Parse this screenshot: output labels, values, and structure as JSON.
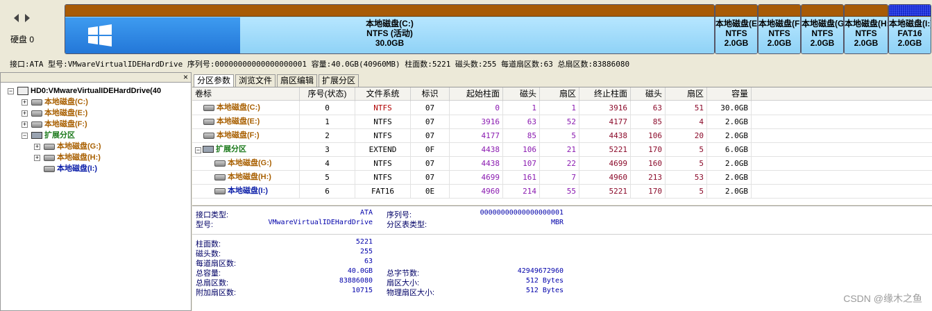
{
  "disk": {
    "label": "硬盘 0",
    "info": "接口:ATA  型号:VMwareVirtualIDEHardDrive  序列号:00000000000000000001  容量:40.0GB(40960MB)  柱面数:5221  磁头数:255  每道扇区数:63  总扇区数:83886080"
  },
  "partitions_bar": [
    {
      "name": "本地磁盘(C:)",
      "fs": "NTFS (活动)",
      "size": "30.0GB",
      "used_fraction": 0.27
    },
    {
      "name": "本地磁盘(E:)",
      "fs": "NTFS",
      "size": "2.0GB",
      "used_fraction": 0
    },
    {
      "name": "本地磁盘(F:)",
      "fs": "NTFS",
      "size": "2.0GB",
      "used_fraction": 0
    },
    {
      "name": "本地磁盘(G:)",
      "fs": "NTFS",
      "size": "2.0GB",
      "used_fraction": 0
    },
    {
      "name": "本地磁盘(H:)",
      "fs": "NTFS",
      "size": "2.0GB",
      "used_fraction": 0
    },
    {
      "name": "本地磁盘(I:)",
      "fs": "FAT16",
      "size": "2.0GB",
      "used_fraction": 0
    }
  ],
  "tree": {
    "close_label": "×",
    "root": "HD0:VMwareVirtualIDEHardDrive(40",
    "items": [
      {
        "label": "本地磁盘(C:)",
        "color": "#a85f00"
      },
      {
        "label": "本地磁盘(E:)",
        "color": "#a85f00"
      },
      {
        "label": "本地磁盘(F:)",
        "color": "#a85f00"
      },
      {
        "label": "扩展分区",
        "color": "#1c7a1c"
      },
      {
        "label": "本地磁盘(G:)",
        "color": "#a85f00"
      },
      {
        "label": "本地磁盘(H:)",
        "color": "#a85f00"
      },
      {
        "label": "本地磁盘(I:)",
        "color": "#0b1ea8"
      }
    ]
  },
  "tabs": [
    "分区参数",
    "浏览文件",
    "扇区编辑",
    "扩展分区"
  ],
  "table": {
    "headers": [
      "卷标",
      "序号(状态)",
      "文件系统",
      "标识",
      "起始柱面",
      "磁头",
      "扇区",
      "终止柱面",
      "磁头",
      "扇区",
      "容量"
    ],
    "rows": [
      {
        "label": "本地磁盘(C:)",
        "idx": "0",
        "fs": "NTFS",
        "id": "07",
        "sc": "0",
        "sh": "1",
        "ss": "1",
        "ec": "3916",
        "eh": "63",
        "es": "51",
        "cap": "30.0GB"
      },
      {
        "label": "本地磁盘(E:)",
        "idx": "1",
        "fs": "NTFS",
        "id": "07",
        "sc": "3916",
        "sh": "63",
        "ss": "52",
        "ec": "4177",
        "eh": "85",
        "es": "4",
        "cap": "2.0GB"
      },
      {
        "label": "本地磁盘(F:)",
        "idx": "2",
        "fs": "NTFS",
        "id": "07",
        "sc": "4177",
        "sh": "85",
        "ss": "5",
        "ec": "4438",
        "eh": "106",
        "es": "20",
        "cap": "2.0GB"
      },
      {
        "label": "扩展分区",
        "idx": "3",
        "fs": "EXTEND",
        "id": "0F",
        "sc": "4438",
        "sh": "106",
        "ss": "21",
        "ec": "5221",
        "eh": "170",
        "es": "5",
        "cap": "6.0GB"
      },
      {
        "label": "本地磁盘(G:)",
        "idx": "4",
        "fs": "NTFS",
        "id": "07",
        "sc": "4438",
        "sh": "107",
        "ss": "22",
        "ec": "4699",
        "eh": "160",
        "es": "5",
        "cap": "2.0GB"
      },
      {
        "label": "本地磁盘(H:)",
        "idx": "5",
        "fs": "NTFS",
        "id": "07",
        "sc": "4699",
        "sh": "161",
        "ss": "7",
        "ec": "4960",
        "eh": "213",
        "es": "53",
        "cap": "2.0GB"
      },
      {
        "label": "本地磁盘(I:)",
        "idx": "6",
        "fs": "FAT16",
        "id": "0E",
        "sc": "4960",
        "sh": "214",
        "ss": "55",
        "ec": "5221",
        "eh": "170",
        "es": "5",
        "cap": "2.0GB"
      }
    ]
  },
  "info": {
    "iface_label": "接口类型:",
    "iface": "ATA",
    "serial_label": "序列号:",
    "serial": "00000000000000000001",
    "model_label": "型号:",
    "model": "VMwareVirtualIDEHardDrive",
    "ptype_label": "分区表类型:",
    "ptype": "MBR",
    "cyl_label": "柱面数:",
    "cyl": "5221",
    "heads_label": "磁头数:",
    "heads": "255",
    "spt_label": "每道扇区数:",
    "spt": "63",
    "cap_label": "总容量:",
    "cap": "40.0GB",
    "bytes_label": "总字节数:",
    "bytes": "42949672960",
    "sectors_label": "总扇区数:",
    "sectors": "83886080",
    "ssize_label": "扇区大小:",
    "ssize": "512 Bytes",
    "extra_label": "附加扇区数:",
    "extra": "10715",
    "psize_label": "物理扇区大小:",
    "psize": "512 Bytes"
  },
  "watermark": "CSDN @缘木之鱼"
}
